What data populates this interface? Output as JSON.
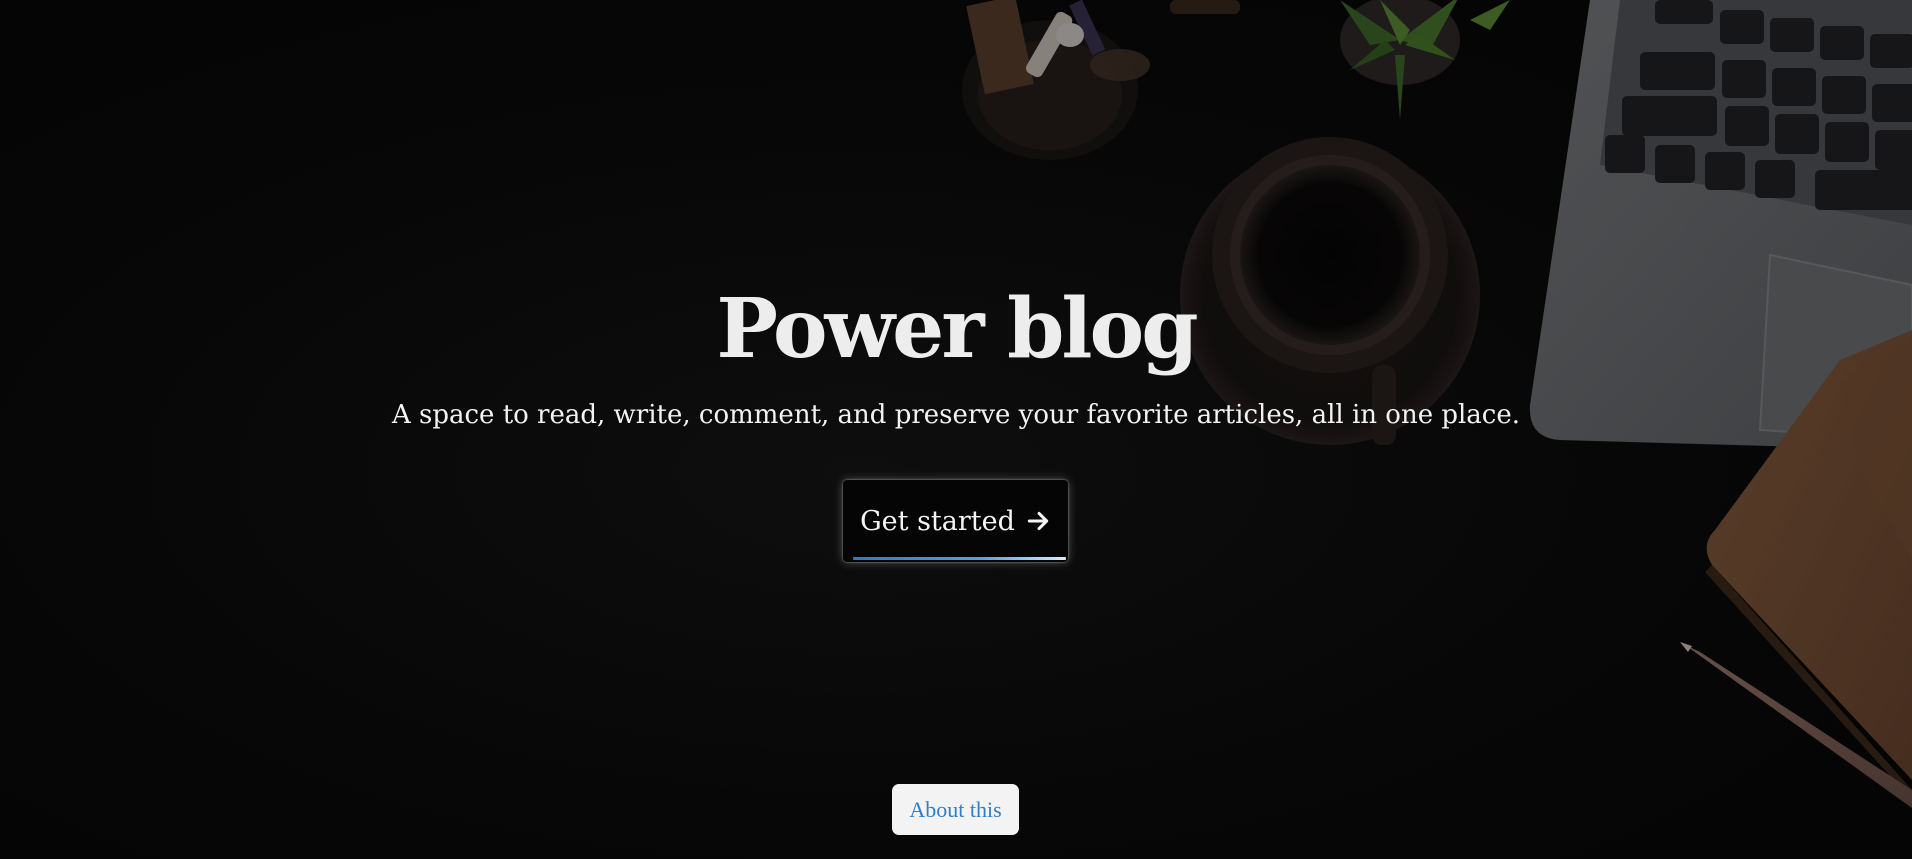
{
  "hero": {
    "title": "Power blog",
    "subtitle": "A space to read, write, comment, and preserve your favorite articles, all in one place.",
    "cta_label": "Get started",
    "cta_icon": "arrow-right-icon",
    "about_label": "About this"
  },
  "colors": {
    "background": "#0a0a0a",
    "title_text": "#ededed",
    "cta_background": "#050505",
    "cta_underline": "#2a7ad0",
    "about_background": "#f3f3f3",
    "about_text": "#2f7fc4"
  }
}
